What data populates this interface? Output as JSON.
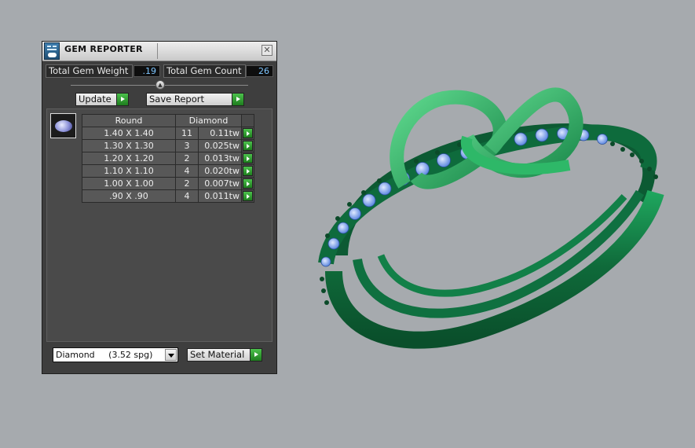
{
  "window": {
    "title": "GEM REPORTER",
    "close_symbol": "✕"
  },
  "totals": {
    "weight_label": "Total Gem Weight",
    "weight_value": ".19",
    "count_label": "Total Gem Count",
    "count_value": "26"
  },
  "actions": {
    "update_label": "Update",
    "save_report_label": "Save Report"
  },
  "gem_table": {
    "shape_header": "Round",
    "material_header": "Diamond",
    "rows": [
      {
        "size": "1.40 X 1.40",
        "count": "11",
        "weight": "0.11tw"
      },
      {
        "size": "1.30 X 1.30",
        "count": "3",
        "weight": "0.025tw"
      },
      {
        "size": "1.20 X 1.20",
        "count": "2",
        "weight": "0.013tw"
      },
      {
        "size": "1.10 X 1.10",
        "count": "4",
        "weight": "0.020tw"
      },
      {
        "size": "1.00 X 1.00",
        "count": "2",
        "weight": "0.007tw"
      },
      {
        "size": ".90 X .90",
        "count": "4",
        "weight": "0.011tw"
      }
    ]
  },
  "material": {
    "selected": "Diamond     (3.52 spg)",
    "set_label": "Set Material"
  },
  "icons": {
    "app": "gem-reporter-app-icon",
    "thumbnail": "round-gem-thumbnail-icon",
    "action_arrow": "green-play-arrow-icon"
  },
  "colors": {
    "viewport_background": "#a6aaae",
    "panel_background": "#3e3e3e",
    "ring_green": "#137a45",
    "gem_blue": "#8ab0f0",
    "value_text": "#7fc6ff",
    "action_green": "#2ea02e"
  }
}
